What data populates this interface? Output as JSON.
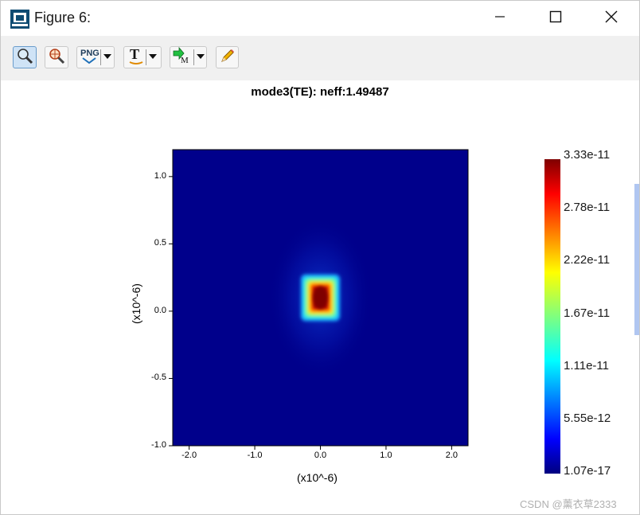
{
  "window": {
    "title": "Figure 6:",
    "controls": [
      "minimize-icon",
      "maximize-icon",
      "close-icon"
    ]
  },
  "toolbar": {
    "buttons": [
      {
        "name": "zoom-button",
        "icon": "magnifier-icon",
        "active": true
      },
      {
        "name": "zoom-reset-button",
        "icon": "magnifier-target-icon",
        "active": false
      },
      {
        "name": "export-png-button",
        "label": "PNG",
        "icon": "png-export-icon",
        "dropdown": true
      },
      {
        "name": "text-tool-button",
        "label": "T",
        "icon": "text-icon",
        "dropdown": true
      },
      {
        "name": "marker-tool-button",
        "label": "M",
        "icon": "marker-icon",
        "dropdown": true
      },
      {
        "name": "edit-button",
        "icon": "pencil-icon",
        "active": false
      }
    ]
  },
  "chart_data": {
    "type": "heatmap",
    "title": "mode3(TE): neff:1.49487",
    "xlabel": "(x10^-6)",
    "ylabel": "(x10^-6)",
    "xlim": [
      -2.25,
      2.25
    ],
    "ylim": [
      -1.0,
      1.2
    ],
    "x_ticks": [
      "-2.0",
      "-1.0",
      "0.0",
      "1.0",
      "2.0"
    ],
    "y_ticks": [
      "-1.0",
      "-0.5",
      "0.0",
      "0.5",
      "1.0"
    ],
    "colormap": "jet",
    "colorbar_ticks": [
      "3.33e-11",
      "2.78e-11",
      "2.22e-11",
      "1.67e-11",
      "1.11e-11",
      "5.55e-12",
      "1.07e-17"
    ],
    "value_min": 1.07e-17,
    "value_max": 3.33e-11,
    "field_peak": {
      "x": 0.0,
      "y": 0.1,
      "value": 3.33e-11
    },
    "core_region": {
      "x": [
        -0.25,
        0.25
      ],
      "y": [
        -0.05,
        0.25
      ]
    }
  },
  "watermark": "CSDN @薰衣草2333",
  "colors": {
    "background": "#ffffff",
    "toolbar_bg": "#f0f0f0",
    "plot_bg": "#00008b",
    "active_button": "#cfe3f6"
  }
}
